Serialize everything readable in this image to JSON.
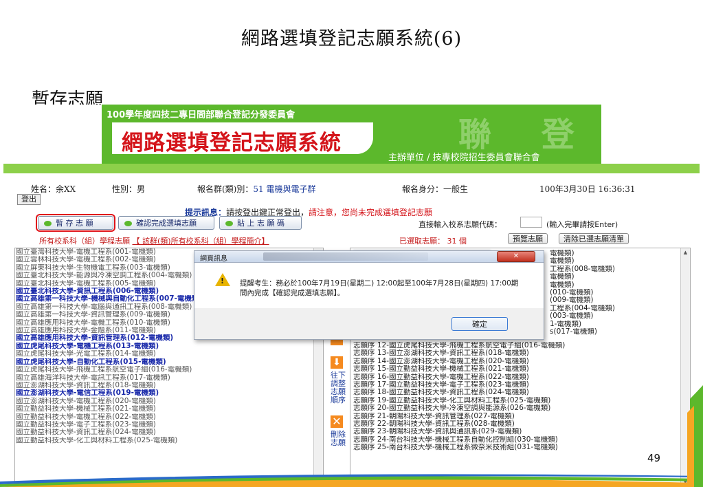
{
  "slide": {
    "title": "網路選填登記志願系統(6)",
    "subtitle": "暫存志願",
    "page_number": "49"
  },
  "banner": {
    "top_text": "100學年度四技二專日間部聯合登記分發委員會",
    "system_name": "網路選填登記志願系統",
    "watermark": "聯 登",
    "organizer": "主辦單位 / 技專校院招生委員會聯合會"
  },
  "user_info": {
    "name": "姓名：余XX",
    "gender": "性別：男",
    "group_label": "報名群(類)別：",
    "group_value": "51 電機與電子群",
    "identity": "報名身分：一般生",
    "datetime": "100年3月30日 16:36:31"
  },
  "logout_label": "登出",
  "prompt": {
    "label": "提示訊息：",
    "normal": "請按登出鍵正常登出，",
    "warning": "請注意，您尚未完成選填登記志願"
  },
  "buttons": {
    "save": "暫 存 志 願",
    "confirm": "確認完成選填志願",
    "paste": "貼 上 志 願 碼",
    "preview": "預覽志願",
    "clear": "清除已選志願清單"
  },
  "code_input": {
    "label": "直接輸入校系志願代碼：",
    "hint": "(輸入完畢請按Enter)"
  },
  "lists_header": {
    "left_label": "所有校系科（組）學程志願",
    "left_link": "【 該群(類)所有校系科（組）學程簡介】",
    "right_label": "已選取志願：",
    "right_count": "31 個"
  },
  "left_list": [
    {
      "text": "國立臺灣科技大學-電機工程系(001-電機類)",
      "hl": false
    },
    {
      "text": "國立雲林科技大學-電機工程系(002-電機類)",
      "hl": false
    },
    {
      "text": "國立屏東科技大學-生物機電工程系(003-電機類)",
      "hl": false
    },
    {
      "text": "國立臺北科技大學-能源與冷凍空調工程系(004-電機類)",
      "hl": false
    },
    {
      "text": "國立臺北科技大學-電機工程系(005-電機類)",
      "hl": false
    },
    {
      "text": "國立臺北科技大學-資訊工程系(006-電機類)",
      "hl": true
    },
    {
      "text": "國立高雄第一科技大學-機械與自動化工程系(007-電機類)",
      "hl": true
    },
    {
      "text": "國立高雄第一科技大學-電腦與通訊工程系(008-電機類)",
      "hl": false
    },
    {
      "text": "國立高雄第一科技大學-資訊管理系(009-電機類)",
      "hl": false
    },
    {
      "text": "國立高雄應用科技大學-電機工程系(010-電機類)",
      "hl": false
    },
    {
      "text": "國立高雄應用科技大學-金融系(011-電機類)",
      "hl": false
    },
    {
      "text": "國立高雄應用科技大學-資訊管理系(012-電機類)",
      "hl": true
    },
    {
      "text": "國立虎尾科技大學-電機工程系(013-電機類)",
      "hl": true
    },
    {
      "text": "國立虎尾科技大學-光電工程系(014-電機類)",
      "hl": false
    },
    {
      "text": "國立虎尾科技大學-自動化工程系(015-電機類)",
      "hl": true
    },
    {
      "text": "國立虎尾科技大學-飛機工程系航空電子組(016-電機類)",
      "hl": false
    },
    {
      "text": "國立高雄海洋科技大學-電訊工程系(017-電機類)",
      "hl": false
    },
    {
      "text": "國立澎湖科技大學-資訊工程系(018-電機類)",
      "hl": false
    },
    {
      "text": "國立澎湖科技大學-電信工程系(019-電機類)",
      "hl": true
    },
    {
      "text": "國立澎湖科技大學-電機工程系(020-電機類)",
      "hl": false
    },
    {
      "text": "國立勤益科技大學-機械工程系(021-電機類)",
      "hl": false
    },
    {
      "text": "國立勤益科技大學-電機工程系(022-電機類)",
      "hl": false
    },
    {
      "text": "國立勤益科技大學-電子工程系(023-電機類)",
      "hl": false
    },
    {
      "text": "國立勤益科技大學-資訊工程系(024-電機類)",
      "hl": false
    },
    {
      "text": "國立勤益科技大學-化工與材料工程系(025-電機類)",
      "hl": false
    }
  ],
  "right_list_partial": [
    "電機類)",
    "電機類)",
    "工程系(008-電機類)",
    "電機類)",
    "電機類)",
    "(010-電機類)",
    "(009-電機類)",
    "工程系(004-電機類)",
    "(003-電機類)",
    "1-電機類)",
    "s(017-電機類)"
  ],
  "right_list": [
    "志願序 12-國立虎尾科技大學-飛機工程系航空電子組(016-電機類)",
    "志願序 13-國立澎湖科技大學-資訊工程系(018-電機類)",
    "志願序 14-國立澎湖科技大學-電機工程系(020-電機類)",
    "志願序 15-國立勤益科技大學-機械工程系(021-電機類)",
    "志願序 16-國立勤益科技大學-電機工程系(022-電機類)",
    "志願序 17-國立勤益科技大學-電子工程系(023-電機類)",
    "志願序 18-國立勤益科技大學-資訊工程系(024-電機類)",
    "志願序 19-國立勤益科技大學-化工與材料工程系(025-電機類)",
    "志願序 20-國立勤益科技大學-冷凍空調與能源系(026-電機類)",
    "志願序 21-朝陽科技大學-資訊管理系(027-電機類)",
    "志願序 22-朝陽科技大學-資訊工程系(028-電機類)",
    "志願序 23-朝陽科技大學-資訊與通訊系(029-電機類)",
    "志願序 24-南台科技大學-機械工程系自動化控制組(030-電機類)",
    "志願序 25-南台科技大學-機械工程系微奈米技術組(031-電機類)"
  ],
  "middle_controls": {
    "reorder": "往下調整志願順序",
    "delete": "刪除志願"
  },
  "dialog": {
    "title": "網頁訊息",
    "close": "✕",
    "message": "提醒考生：務必於100年7月19日(星期二) 12:00起至100年7月28日(星期四) 17:00期間內完成【確認完成選填志願】。",
    "ok": "確定"
  }
}
